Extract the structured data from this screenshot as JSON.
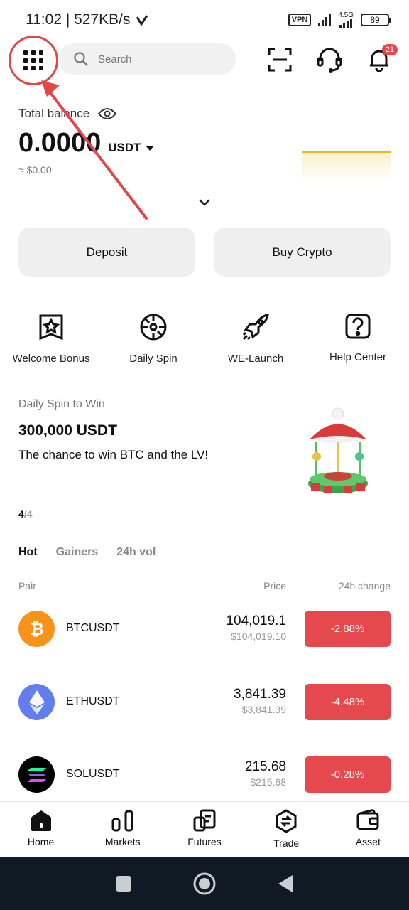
{
  "status_bar": {
    "time_speed": "11:02 | 527KB/s",
    "vpn": "VPN",
    "network": "4.5G",
    "battery": "89"
  },
  "search": {
    "placeholder": "Search"
  },
  "notifications": {
    "count": "21"
  },
  "balance": {
    "label": "Total balance",
    "value": "0.0000",
    "unit": "USDT",
    "fiat": "≈ $0.00"
  },
  "actions": {
    "deposit": "Deposit",
    "buy_crypto": "Buy Crypto"
  },
  "shortcuts": [
    {
      "label": "Welcome Bonus",
      "icon": "bonus-icon"
    },
    {
      "label": "Daily Spin",
      "icon": "spin-icon"
    },
    {
      "label": "WE-Launch",
      "icon": "rocket-icon"
    },
    {
      "label": "Help Center",
      "icon": "help-icon"
    }
  ],
  "promo": {
    "subtitle": "Daily Spin to Win",
    "title": "300,000 USDT",
    "description": "The chance to win BTC and the LV!",
    "page_current": "4",
    "page_sep": "/",
    "page_total": "4"
  },
  "market": {
    "tabs": [
      "Hot",
      "Gainers",
      "24h vol"
    ],
    "col_pair": "Pair",
    "col_price": "Price",
    "col_change": "24h change",
    "rows": [
      {
        "pair": "BTCUSDT",
        "price": "104,019.1",
        "fiat": "$104,019.10",
        "change": "-2.88%",
        "color": "#f7931a"
      },
      {
        "pair": "ETHUSDT",
        "price": "3,841.39",
        "fiat": "$3,841.39",
        "change": "-4.48%",
        "color": "#627eea"
      },
      {
        "pair": "SOLUSDT",
        "price": "215.68",
        "fiat": "$215.68",
        "change": "-0.28%",
        "color": "#000000"
      }
    ]
  },
  "nav": [
    {
      "label": "Home",
      "icon": "home-icon"
    },
    {
      "label": "Markets",
      "icon": "markets-icon"
    },
    {
      "label": "Futures",
      "icon": "futures-icon"
    },
    {
      "label": "Trade",
      "icon": "trade-icon"
    },
    {
      "label": "Asset",
      "icon": "wallet-icon"
    }
  ],
  "colors": {
    "accent_red": "#e5484d",
    "annotation_red": "#e04848",
    "chart_gold": "#e8b92b"
  }
}
